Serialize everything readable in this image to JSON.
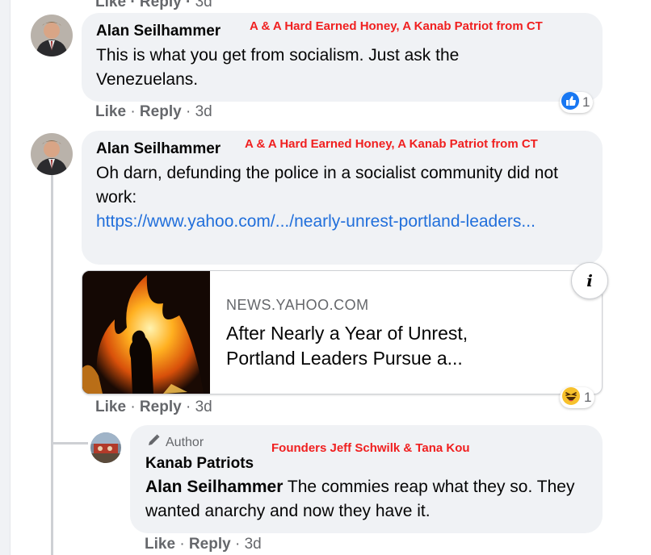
{
  "prev_comment_actions": {
    "like": "Like",
    "reply": "Reply",
    "age": "3d"
  },
  "comments": [
    {
      "name": "Alan Seilhammer",
      "badge": "A & A Hard Earned Honey, A Kanab Patriot from CT",
      "text": "This is what you get from socialism. Just ask the Venezuelans.",
      "reaction": {
        "icon": "like-reaction-icon",
        "count": "1"
      },
      "actions": {
        "like": "Like",
        "reply": "Reply",
        "age": "3d"
      }
    },
    {
      "name": "Alan Seilhammer",
      "badge": "A & A Hard Earned Honey, A Kanab Patriot from CT",
      "text": "Oh darn, defunding the police in a socialist community did not work:",
      "link_text": "https://www.yahoo.com/.../nearly-unrest-portland-leaders...",
      "link_card": {
        "domain": "NEWS.YAHOO.COM",
        "title": "After Nearly a Year of Unrest, Portland Leaders Pursue a...",
        "info_icon": "i"
      },
      "reaction": {
        "icon": "haha-reaction-icon",
        "count": "1"
      },
      "actions": {
        "like": "Like",
        "reply": "Reply",
        "age": "3d"
      }
    }
  ],
  "reply": {
    "author_label": "Author",
    "author_icon": "pencil-icon",
    "badge": "Founders Jeff Schwilk & Tana Kou",
    "name": "Kanab Patriots",
    "mention": "Alan Seilhammer",
    "text": " The commies reap what they so. They wanted anarchy and now they have it.",
    "actions": {
      "like": "Like",
      "reply": "Reply",
      "age": "3d"
    }
  },
  "colors": {
    "bubble": "#f0f2f5",
    "link": "#216fdb",
    "badge": "#f02020",
    "meta": "#65676b",
    "like_blue": "#1877f2"
  }
}
